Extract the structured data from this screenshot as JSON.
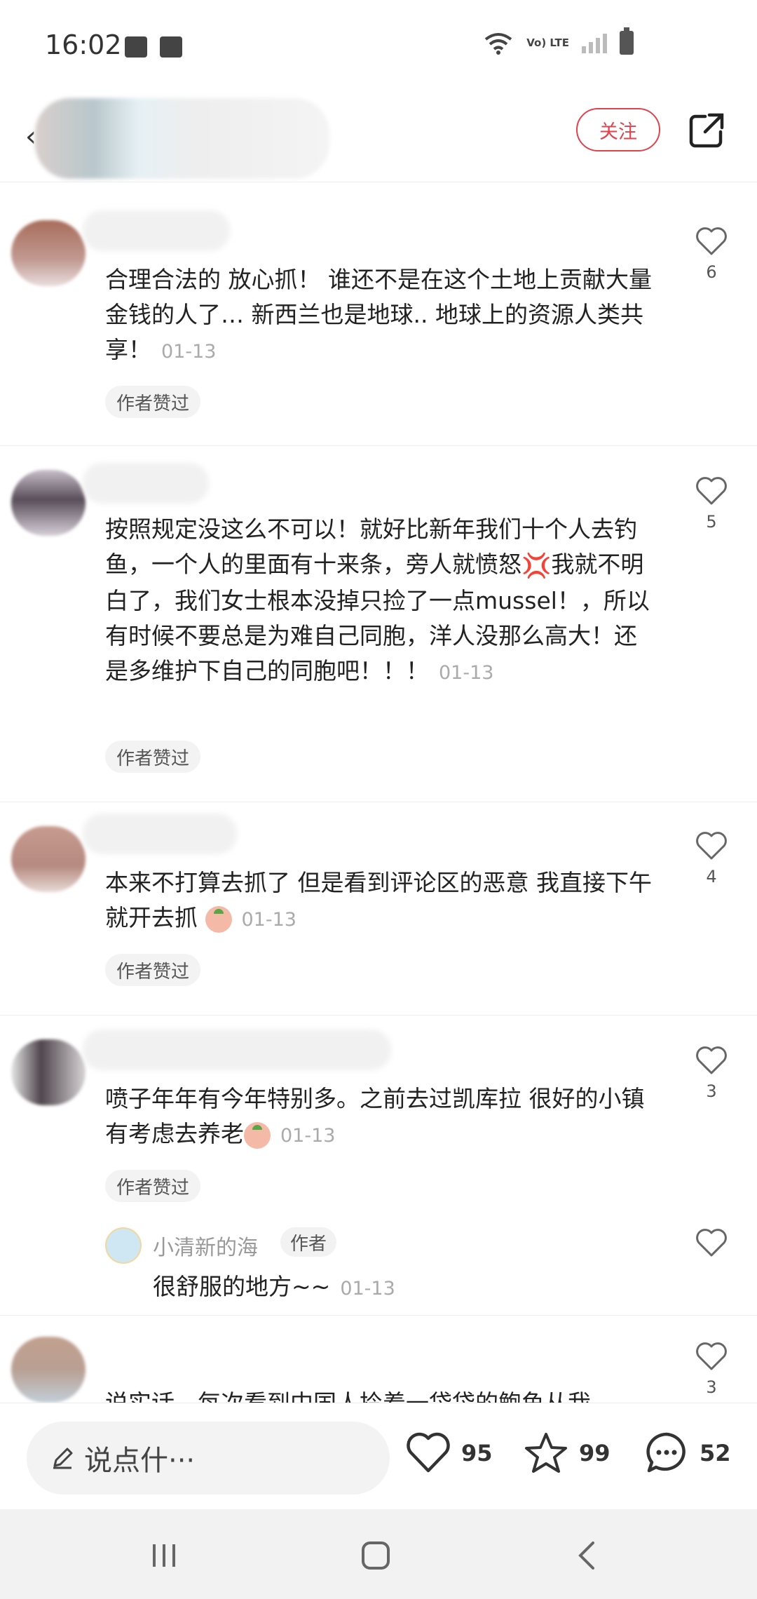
{
  "status_bar": {
    "time": "16:02",
    "network": "Vo) LTE"
  },
  "header": {
    "follow_label": "关注"
  },
  "comments": [
    {
      "text": "合理合法的 放心抓！ 谁还不是在这个土地上贡献大量金钱的人了… 新西兰也是地球.. 地球上的资源人类共享！",
      "date": "01-13",
      "likes": "6",
      "tag": "作者赞过"
    },
    {
      "text": "按照规定没这么不可以！就好比新年我们十个人去钓鱼，一个人的里面有十来条，旁人就愤怒",
      "text2": "我就不明白了，我们女士根本没掉只捡了一点mussel！，所以有时候不要总是为难自己同胞，洋人没那么高大！还是多维护下自己的同胞吧！！！",
      "date": "01-13",
      "likes": "5",
      "tag": "作者赞过"
    },
    {
      "text": "本来不打算去抓了 但是看到评论区的恶意 我直接下午就开去抓",
      "date": "01-13",
      "likes": "4",
      "tag": "作者赞过"
    },
    {
      "text": "喷子年年有今年特别多。之前去过凯库拉 很好的小镇有考虑去养老",
      "date": "01-13",
      "likes": "3",
      "tag": "作者赞过"
    },
    {
      "text": "说实话，每次看到中国人拎着一袋袋的鲍鱼从我",
      "likes": "3"
    }
  ],
  "reply": {
    "name": "小清新的海",
    "badge": "作者",
    "text": "很舒服的地方~~",
    "date": "01-13"
  },
  "action_bar": {
    "input_placeholder": "说点什···",
    "likes": "95",
    "stars": "99",
    "comments": "52"
  },
  "colors": {
    "accent": "#e0434d"
  }
}
